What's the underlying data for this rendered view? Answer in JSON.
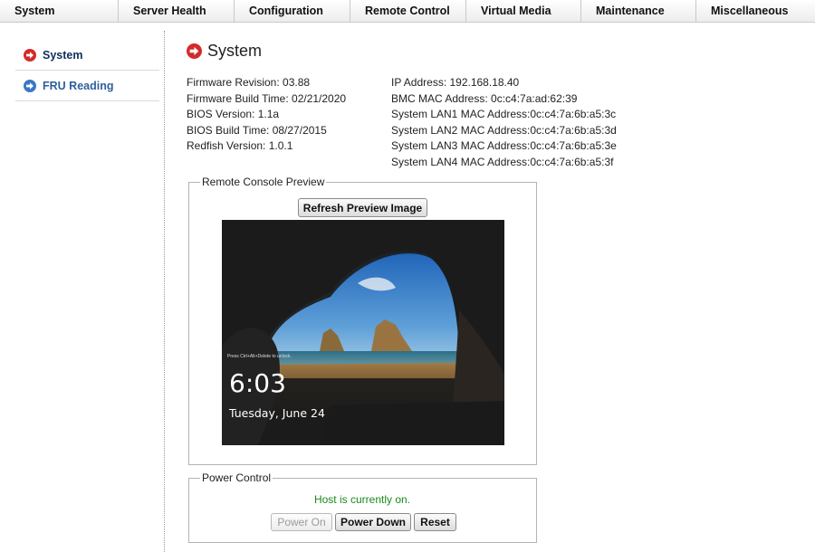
{
  "topnav": {
    "items": [
      "System",
      "Server Health",
      "Configuration",
      "Remote Control",
      "Virtual Media",
      "Maintenance",
      "Miscellaneous"
    ]
  },
  "sidebar": {
    "items": [
      {
        "label": "System",
        "icon": "arrow-right-circle-icon",
        "color": "#d42a2a"
      },
      {
        "label": "FRU Reading",
        "icon": "arrow-right-circle-icon",
        "color": "#3b78c4"
      }
    ]
  },
  "page": {
    "title": "System"
  },
  "firmware_info": [
    "Firmware Revision:  03.88",
    "Firmware Build Time:  02/21/2020",
    "BIOS Version: 1.1a",
    "BIOS Build Time: 08/27/2015",
    "Redfish Version: 1.0.1"
  ],
  "network_info": [
    "IP Address:  192.168.18.40",
    "BMC MAC Address:  0c:c4:7a:ad:62:39",
    "System LAN1 MAC Address:0c:c4:7a:6b:a5:3c",
    "System LAN2 MAC Address:0c:c4:7a:6b:a5:3d",
    "System LAN3 MAC Address:0c:c4:7a:6b:a5:3e",
    "System LAN4 MAC Address:0c:c4:7a:6b:a5:3f"
  ],
  "console_preview": {
    "legend": "Remote Console Preview",
    "refresh_label": "Refresh Preview Image",
    "screen": {
      "time": "6:03",
      "date": "Tuesday, June 24",
      "tiny_text": "Press Ctrl+Alt+Delete to unlock."
    }
  },
  "power_control": {
    "legend": "Power Control",
    "status": "Host is currently on.",
    "status_color": "#1a8a1a",
    "power_on_label": "Power On",
    "power_down_label": "Power Down",
    "reset_label": "Reset"
  }
}
